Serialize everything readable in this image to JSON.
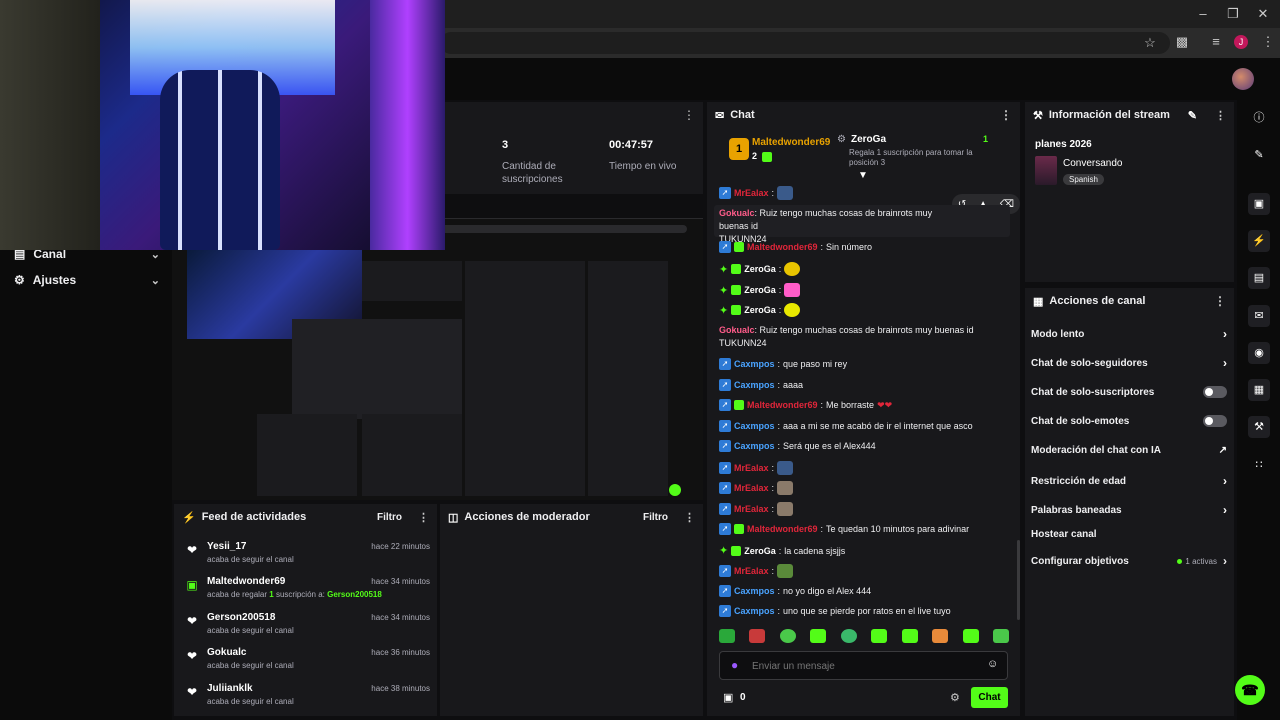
{
  "browser": {
    "minimize_icon": "minimize-icon",
    "restore_icon": "restore-icon",
    "close_icon": "close-icon",
    "profile_initial": "J"
  },
  "sidebar": {
    "items": [
      {
        "label": "Canal",
        "icon": "tv-icon"
      },
      {
        "label": "Ajustes",
        "icon": "gear-icon"
      }
    ]
  },
  "stats": [
    {
      "value": "3",
      "label": "Cantidad de suscripciones"
    },
    {
      "value": "00:47:57",
      "label": "Tiempo en vivo"
    }
  ],
  "feed": {
    "title": "Feed de actividades",
    "filter_label": "Filtro",
    "items": [
      {
        "user": "Yesii_17",
        "time": "hace 22 minutos",
        "desc": "acaba de seguir el canal",
        "icon": "heart-icon"
      },
      {
        "user": "Maltedwonder69",
        "time": "hace 34 minutos",
        "desc_prefix": "acaba de regalar",
        "desc_count": "1",
        "desc_mid": "suscripción a:",
        "desc_target": "Gerson200518",
        "icon": "gift-icon"
      },
      {
        "user": "Gerson200518",
        "time": "hace 34 minutos",
        "desc": "acaba de seguir el canal",
        "icon": "heart-icon"
      },
      {
        "user": "Gokualc",
        "time": "hace 36 minutos",
        "desc": "acaba de seguir el canal",
        "icon": "heart-icon"
      },
      {
        "user": "Juliianklk",
        "time": "hace 38 minutos",
        "desc": "acaba de seguir el canal",
        "icon": "heart-icon"
      }
    ]
  },
  "moderator": {
    "title": "Acciones de moderador",
    "filter_label": "Filtro"
  },
  "chat": {
    "title": "Chat",
    "leader": {
      "rank": "1",
      "name": "Maltedwonder69",
      "count": "2"
    },
    "gift_top": {
      "name": "ZeroGa",
      "note": "Regala 1 suscripción para tomar la posición 3",
      "count": "1"
    },
    "messages": [
      {
        "user": "MrEalax",
        "text": "",
        "color": "red"
      },
      {
        "user": "Gokualc",
        "text": "Ruiz tengo muchas cosas de brainrots muy buenas id",
        "text2": "TUKUNN24",
        "color": "pink"
      },
      {
        "user": "Maltedwonder69",
        "text": "Sin número",
        "color": "red"
      },
      {
        "user": "ZeroGa",
        "text": "",
        "color": "white"
      },
      {
        "user": "ZeroGa",
        "text": "",
        "color": "white"
      },
      {
        "user": "ZeroGa",
        "text": "",
        "color": "white"
      },
      {
        "user": "Gokualc",
        "text": "Ruiz tengo muchas cosas de brainrots muy buenas id",
        "text2": "TUKUNN24",
        "color": "pink"
      },
      {
        "user": "Caxmpos",
        "text": "que paso mi rey",
        "color": "blue"
      },
      {
        "user": "Caxmpos",
        "text": "aaaa",
        "color": "blue"
      },
      {
        "user": "Maltedwonder69",
        "text": "Me borraste",
        "color": "red"
      },
      {
        "user": "Caxmpos",
        "text": "aaa a mi se me acabó de ir el internet que asco",
        "color": "blue"
      },
      {
        "user": "Caxmpos",
        "text": "Será que es el Alex444",
        "color": "blue"
      },
      {
        "user": "MrEalax",
        "text": "",
        "color": "red"
      },
      {
        "user": "MrEalax",
        "text": "",
        "color": "red"
      },
      {
        "user": "MrEalax",
        "text": "",
        "color": "red"
      },
      {
        "user": "Maltedwonder69",
        "text": "Te quedan 10 minutos para adivinar",
        "color": "red"
      },
      {
        "user": "ZeroGa",
        "text": "la cadena sjsjjs",
        "color": "white"
      },
      {
        "user": "MrEalax",
        "text": "",
        "color": "red"
      },
      {
        "user": "Caxmpos",
        "text": "no yo digo el Alex 444",
        "color": "blue"
      },
      {
        "user": "Caxmpos",
        "text": "uno que se pierde por ratos en el live tuyo",
        "color": "blue"
      }
    ],
    "input_placeholder": "Enviar un mensaje",
    "points": "0",
    "send_label": "Chat"
  },
  "stream_info": {
    "title": "Información del stream",
    "stream_title": "planes 2026",
    "category": "Conversando",
    "language": "Spanish"
  },
  "channel_actions": {
    "title": "Acciones de canal",
    "items": [
      {
        "label": "Modo lento",
        "control": "chevron"
      },
      {
        "label": "Chat de solo-seguidores",
        "control": "chevron"
      },
      {
        "label": "Chat de solo-suscriptores",
        "control": "toggle"
      },
      {
        "label": "Chat de solo-emotes",
        "control": "toggle"
      },
      {
        "label": "Moderación del chat con IA",
        "control": "external"
      },
      {
        "label": "Restricción de edad",
        "control": "chevron"
      },
      {
        "label": "Palabras baneadas",
        "control": "chevron"
      },
      {
        "label": "Hostear canal",
        "control": "none"
      },
      {
        "label": "Configurar objetivos",
        "control": "chevron",
        "badge": "1 activas"
      }
    ]
  },
  "colors": {
    "accent": "#53fc18",
    "panel": "#18181b",
    "background": "#0e0e10"
  }
}
